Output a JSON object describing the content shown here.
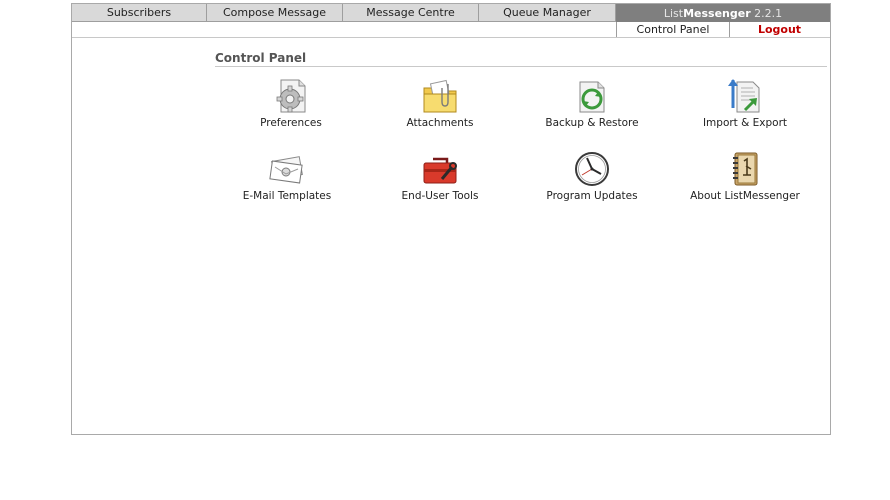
{
  "tabs": [
    "Subscribers",
    "Compose Message",
    "Message Centre",
    "Queue Manager"
  ],
  "brand": {
    "light": "List",
    "bold": "Messenger",
    "version": " 2.2.1"
  },
  "subnav": {
    "control_panel": "Control Panel",
    "logout": "Logout"
  },
  "panel": {
    "title": "Control Panel",
    "items": [
      {
        "label": "Preferences",
        "icon": "preferences-gear-icon"
      },
      {
        "label": "Attachments",
        "icon": "folder-paperclip-icon"
      },
      {
        "label": "Backup & Restore",
        "icon": "backup-restore-icon"
      },
      {
        "label": "Import & Export",
        "icon": "import-export-icon"
      },
      {
        "label": "E-Mail Templates",
        "icon": "email-envelope-icon"
      },
      {
        "label": "End-User Tools",
        "icon": "toolbox-icon"
      },
      {
        "label": "Program Updates",
        "icon": "clock-icon"
      },
      {
        "label": "About ListMessenger",
        "icon": "address-book-icon"
      }
    ]
  },
  "colors": {
    "tab_bg": "#d9d9d9",
    "brand_bg": "#7f7f7f",
    "logout": "#c00000"
  }
}
